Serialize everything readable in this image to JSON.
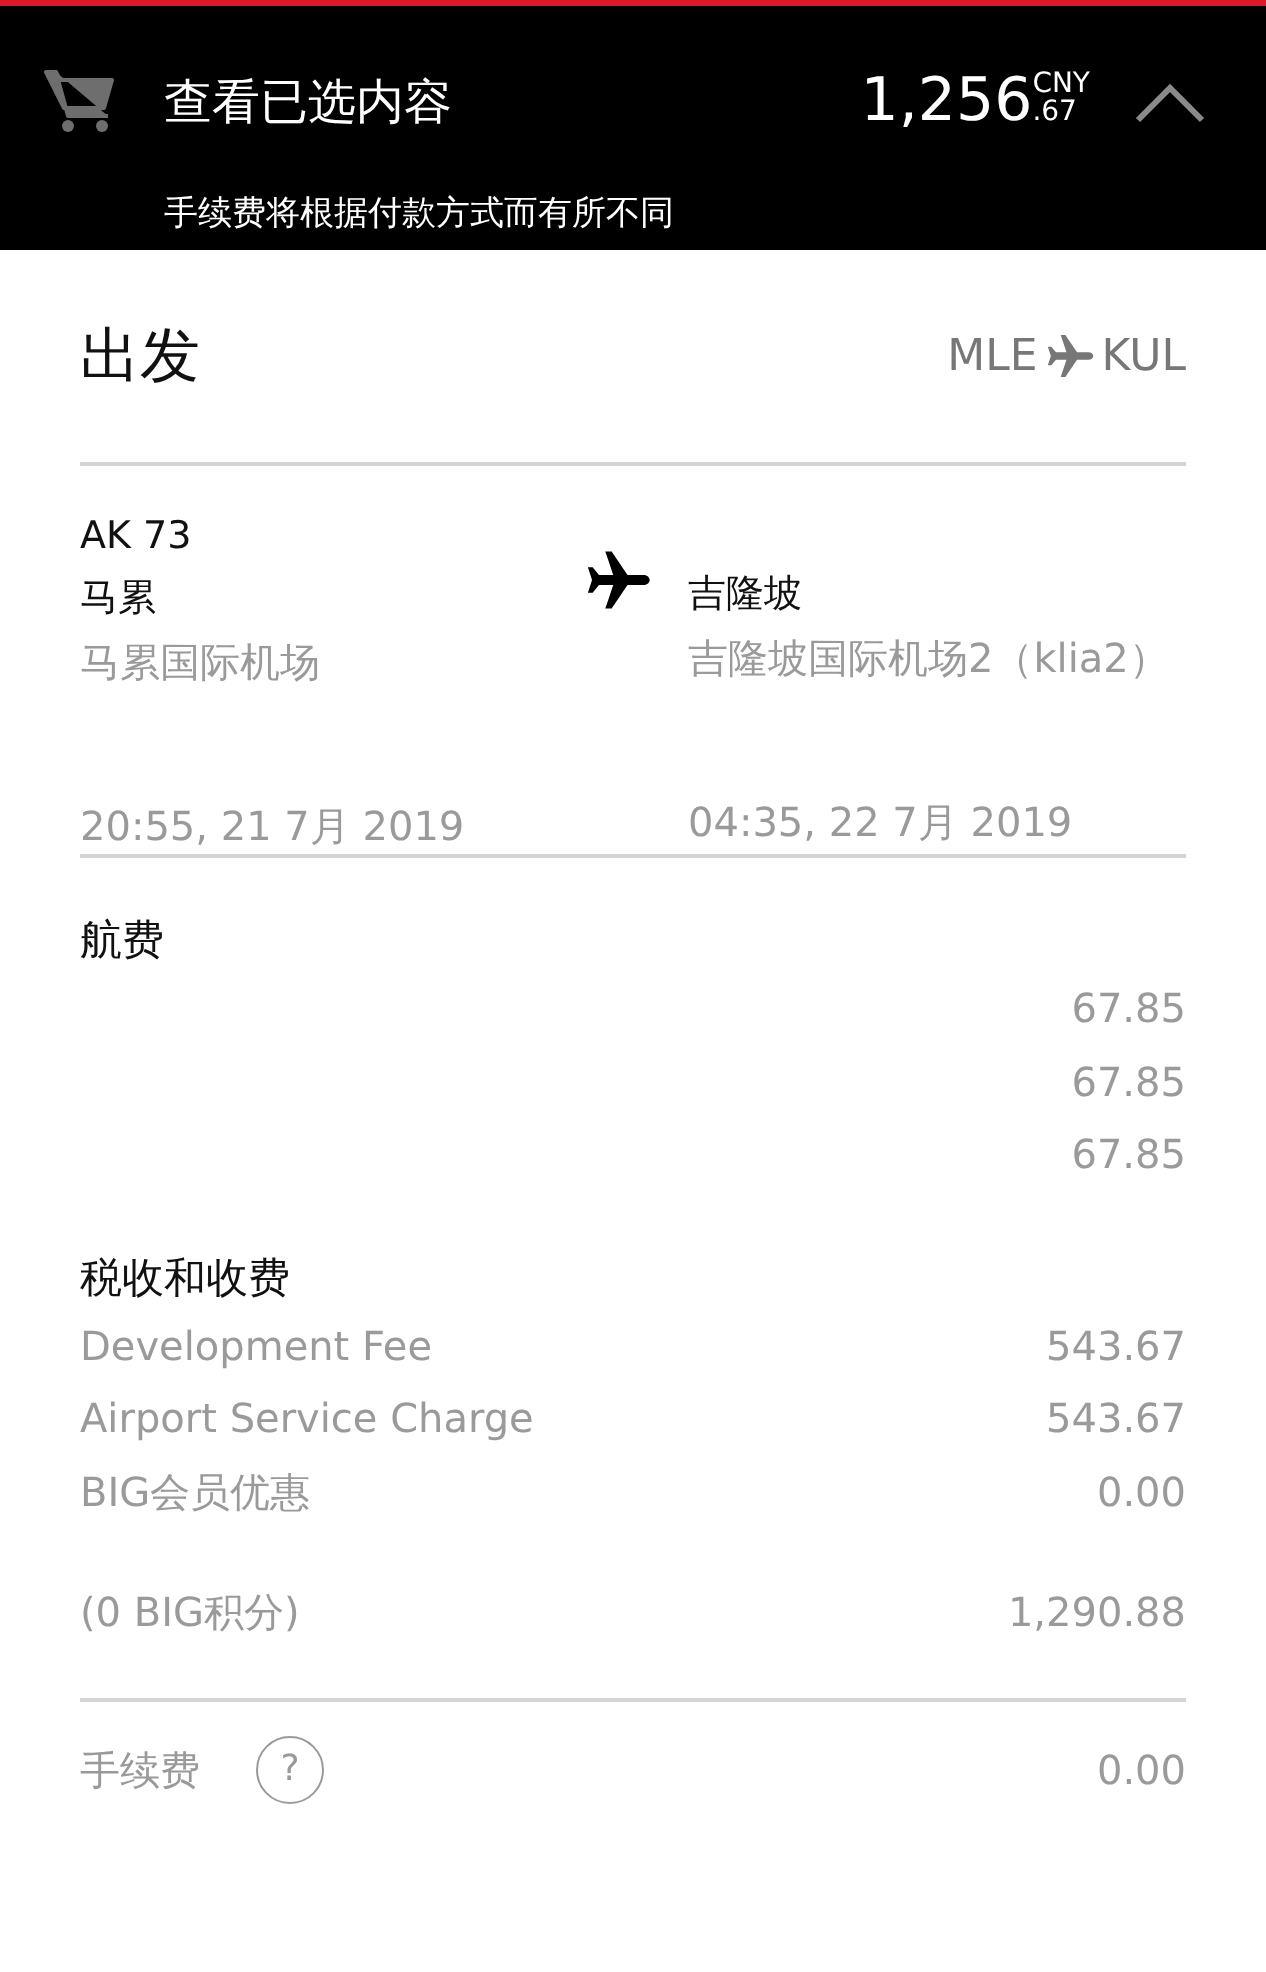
{
  "summary_bar": {
    "title": "查看已选内容",
    "amount_whole": "1,256",
    "amount_cents": ".67",
    "currency": "CNY",
    "expanded": true,
    "note": "手续费将根据付款方式而有所不同"
  },
  "journey": {
    "title": "出发",
    "origin_code": "MLE",
    "destination_code": "KUL"
  },
  "flight": {
    "number": "AK 73",
    "departure": {
      "city": "马累",
      "airport": "马累国际机场",
      "time": "20:55, 21 7月 2019"
    },
    "arrival": {
      "city": "吉隆坡",
      "airport": "吉隆坡国际机场2（klia2）",
      "time": "04:35, 22 7月 2019"
    }
  },
  "fare": {
    "title": "航费",
    "amounts": [
      "67.85",
      "67.85",
      "67.85"
    ]
  },
  "taxes": {
    "title": "税收和收费",
    "rows": [
      {
        "label": "Development Fee",
        "amount": "543.67"
      },
      {
        "label": "Airport Service Charge",
        "amount": "543.67"
      },
      {
        "label": "BIG会员优惠",
        "amount": "0.00"
      }
    ]
  },
  "points": {
    "label": "(0 BIG积分)",
    "amount": "1,290.88"
  },
  "fee": {
    "label": "手续费",
    "help": "?",
    "amount": "0.00"
  }
}
